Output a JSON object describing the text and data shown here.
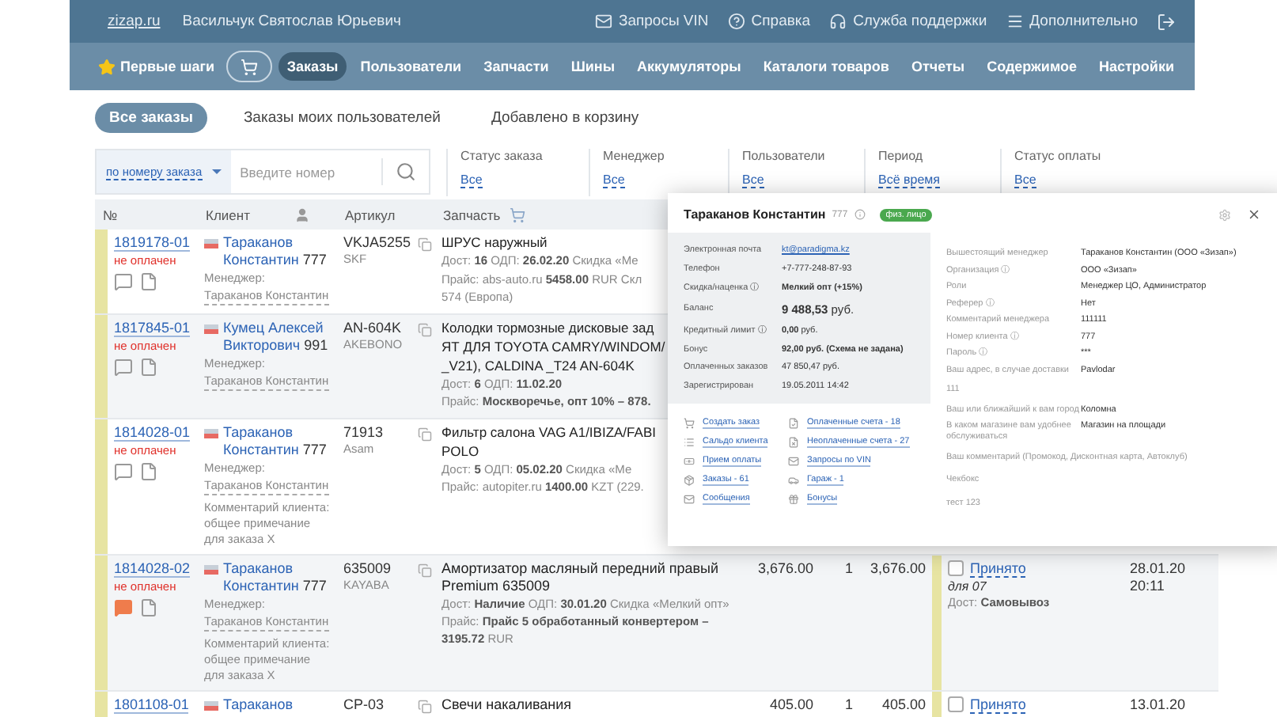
{
  "top_bar": {
    "site": "zizap.ru",
    "user": "Васильчук Святослав Юрьевич",
    "links": [
      "Запросы VIN",
      "Справка",
      "Служба поддержки",
      "Дополнительно"
    ]
  },
  "nav": {
    "first_steps": "Первые шаги",
    "items": [
      {
        "label": "Заказы",
        "selected": true
      },
      {
        "label": "Пользователи",
        "selected": false
      },
      {
        "label": "Запчасти",
        "selected": false
      },
      {
        "label": "Шины",
        "selected": false
      },
      {
        "label": "Аккумуляторы",
        "selected": false
      },
      {
        "label": "Каталоги товаров",
        "selected": false
      },
      {
        "label": "Отчеты",
        "selected": false
      },
      {
        "label": "Содержимое",
        "selected": false
      },
      {
        "label": "Настройки",
        "selected": false
      }
    ]
  },
  "tabs": [
    {
      "label": "Все заказы",
      "selected": true
    },
    {
      "label": "Заказы моих пользователей",
      "selected": false
    },
    {
      "label": "Добавлено в корзину",
      "selected": false
    }
  ],
  "search": {
    "mode": "по номеру заказа",
    "placeholder": "Введите номер"
  },
  "filters": [
    {
      "label": "Статус заказа",
      "value": "Все"
    },
    {
      "label": "Менеджер",
      "value": "Все"
    },
    {
      "label": "Пользователи",
      "value": "Все"
    },
    {
      "label": "Период",
      "value": "Всё время"
    },
    {
      "label": "Статус оплаты",
      "value": "Все"
    }
  ],
  "table": {
    "columns": [
      "№",
      "Клиент",
      "Артикул",
      "Запчасть"
    ],
    "rows": [
      {
        "number": "1819178-01",
        "payment": "не оплачен",
        "new_comment": false,
        "client": {
          "name": "Тараканов Константин",
          "code": "777",
          "manager_label": "Менеджер:",
          "manager": "Тараканов Константин"
        },
        "article": {
          "code": "VKJA5255",
          "brand": "SKF"
        },
        "part": {
          "title_lines": [
            "ШРУС наружный"
          ],
          "details": [
            "Дост: **16** ОДП: **26.02.20** Скидка «Ме",
            "Прайс: abs-auto.ru **5458.00** RUR Скл",
            "574 (Европа)"
          ]
        }
      },
      {
        "number": "1817845-01",
        "payment": "не оплачен",
        "new_comment": false,
        "client": {
          "name": "Кумец Алексей Викторович",
          "code": "991",
          "manager_label": "Менеджер:",
          "manager": "Тараканов Константин"
        },
        "article": {
          "code": "AN-604K",
          "brand": "AKEBONO"
        },
        "part": {
          "title_lines": [
            "Колодки тормозные дисковые зад",
            "ЯТ ДЛЯ TOYOTA CAMRY/WINDOM/",
            "_V21), CALDINA _T24 AN-604K"
          ],
          "details": [
            "Дост: **6** ОДП: **11.02.20**",
            "Прайс: **Москворечье, опт 10% – 878.**"
          ]
        }
      },
      {
        "number": "1814028-01",
        "payment": "не оплачен",
        "new_comment": false,
        "client": {
          "name": "Тараканов Константин",
          "code": "777",
          "manager_label": "Менеджер:",
          "manager": "Тараканов Константин",
          "comment": "Комментарий клиента: общее примечание для заказа Х"
        },
        "article": {
          "code": "71913",
          "brand": "Asam"
        },
        "part": {
          "title_lines": [
            "Фильтр салона VAG A1/IBIZA/FABI",
            "POLO"
          ],
          "details": [
            "Дост: **5** ОДП: **05.02.20** Скидка «Ме",
            "Прайс: autopiter.ru **1400.00** KZT (229."
          ]
        }
      },
      {
        "number": "1814028-02",
        "payment": "не оплачен",
        "new_comment": true,
        "client": {
          "name": "Тараканов Константин",
          "code": "777",
          "manager_label": "Менеджер:",
          "manager": "Тараканов Константин",
          "comment": "Комментарий клиента: общее примечание для заказа Х"
        },
        "article": {
          "code": "635009",
          "brand": "KAYABA"
        },
        "part": {
          "title_lines": [
            "Амортизатор масляный передний правый Premium 635009"
          ],
          "details": [
            "Дост: **Наличие** ОДП: **30.01.20** Скидка «Мелкий опт»",
            "Прайс: **Прайс 5 обработанный конвертером – 3195.72** RUR"
          ]
        },
        "price": "3,676.00",
        "qty": "1",
        "sum": "3,676.00",
        "status": {
          "label": "Принято",
          "checked": false,
          "note": "для 07",
          "delivery": "Дост: **Самовывоз**"
        },
        "date": "28.01.20",
        "time": "20:11"
      },
      {
        "number": "1801108-01",
        "client": {
          "name": "Тараканов"
        },
        "article": {
          "code": "CP-03"
        },
        "part": {
          "title_lines": [
            "Свечи накаливания"
          ]
        },
        "price": "405.00",
        "qty": "1",
        "sum": "405.00",
        "status": {
          "label": "Принято",
          "checked": false
        },
        "date": "13.01.20"
      }
    ]
  },
  "client_popup": {
    "name": "Тараканов Константин",
    "code": "777",
    "badge": "физ. лицо",
    "info": [
      {
        "label": "Электронная почта",
        "value": "kt@paradigma.kz",
        "kind": "link",
        "strong": false
      },
      {
        "label": "Телефон",
        "value": "+7-777-248-87-93",
        "kind": "text",
        "strong": false
      },
      {
        "label": "Скидка/наценка ⓘ",
        "value": "Мелкий опт (+15%)",
        "kind": "text",
        "strong": true
      },
      {
        "label": "Баланс",
        "value": "**9 488,53** руб.",
        "kind": "big",
        "strong": false
      },
      {
        "label": "Кредитный лимит ⓘ",
        "value": "**0,00** руб.",
        "kind": "text",
        "strong": false
      },
      {
        "label": "Бонус",
        "value": "92,00 руб. (Схема не задана)",
        "kind": "text",
        "strong": true
      },
      {
        "label": "Оплаченных заказов",
        "value": "47 850,47 руб.",
        "kind": "text",
        "strong": false
      },
      {
        "label": "Зарегистрирован",
        "value": "19.05.2011 14:42",
        "kind": "text",
        "strong": false
      }
    ],
    "links": [
      "Создать заказ",
      "Оплаченные счета - 18",
      "Сальдо клиента",
      "Неоплаченные счета - 27",
      "Прием оплаты",
      "Запросы по VIN",
      "Заказы - 61",
      "Гараж - 1",
      "Сообщения",
      "Бонусы"
    ],
    "details": [
      {
        "label": "Вышестоящий менеджер",
        "value": "Тараканов Константин (ООО «Зизап»)"
      },
      {
        "label": "Организация ⓘ",
        "value": "ООО «Зизап»"
      },
      {
        "label": "Роли",
        "value": "Менеджер ЦО, Администратор"
      },
      {
        "label": "Реферер ⓘ",
        "value": "Нет"
      },
      {
        "label": "Комментарий менеджера",
        "value": "111111"
      },
      {
        "label": "Номер клиента ⓘ",
        "value": "777"
      },
      {
        "label": "Пароль ⓘ",
        "value": "***"
      },
      {
        "label": "Ваш адрес, в случае доставки",
        "value": "Pavlodar"
      },
      {
        "label": "111"
      },
      {
        "label": "Ваш или ближайший к вам город",
        "value": "Коломна"
      },
      {
        "label": "В каком магазине вам удобнее обслуживаться",
        "value": "Магазин на площади"
      },
      {
        "label": "Ваш комментарий (Промокод, Дисконтная карта, Автоклуб)"
      },
      {
        "label": "Чекбокс"
      },
      {
        "label": "тест 123"
      }
    ]
  }
}
